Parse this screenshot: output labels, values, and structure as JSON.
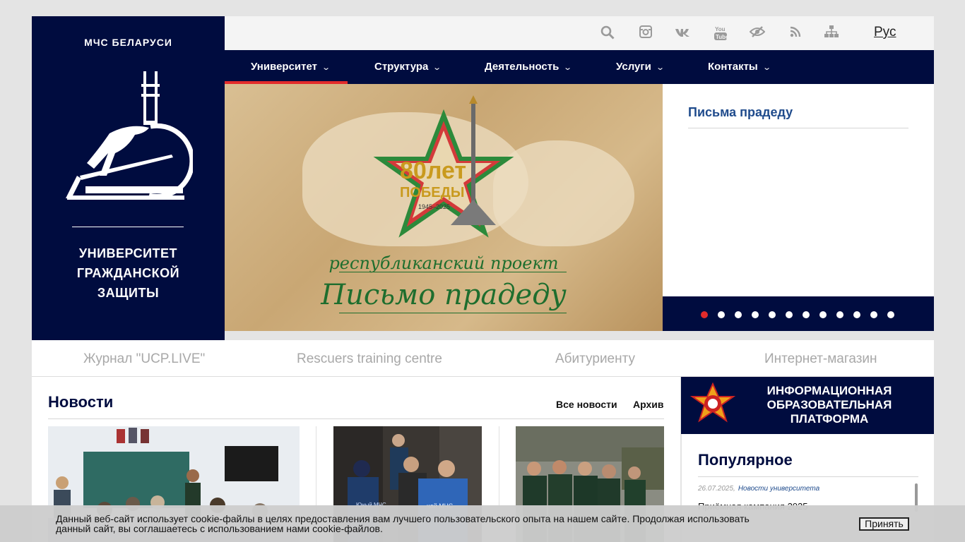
{
  "brand": {
    "org": "МЧС БЕЛАРУСИ",
    "university_line1": "УНИВЕРСИТЕТ",
    "university_line2": "ГРАЖДАНСКОЙ",
    "university_line3": "ЗАЩИТЫ"
  },
  "topbar": {
    "icons": [
      "search-icon",
      "instagram-icon",
      "vk-icon",
      "youtube-icon",
      "accessibility-eye-icon",
      "rss-icon",
      "sitemap-icon"
    ],
    "lang": "Рус"
  },
  "nav": {
    "items": [
      {
        "label": "Университет",
        "active": true
      },
      {
        "label": "Структура"
      },
      {
        "label": "Деятельность"
      },
      {
        "label": "Услуги"
      },
      {
        "label": "Контакты"
      }
    ]
  },
  "slider": {
    "badge_years": "80лет",
    "badge_word": "ПОБЕДЫ",
    "badge_range": "1945–2025",
    "project_text": "республиканский проект",
    "letter_text": "Письмо прадеду",
    "side_title": "Письма прадеду",
    "dot_count": 12,
    "active_dot": 0,
    "colors": {
      "accent": "#e32b2b",
      "navy": "#000c3f",
      "green": "#1e6e2e"
    }
  },
  "quick_links": [
    "Журнал \"UCP.LIVE\"",
    "Rescuers training centre",
    "Абитуриенту",
    "Интернет-магазин"
  ],
  "news": {
    "heading": "Новости",
    "all_news": "Все новости",
    "archive": "Архив"
  },
  "info_banner": {
    "line1": "ИНФОРМАЦИОННАЯ",
    "line2": "ОБРАЗОВАТЕЛЬНАЯ",
    "line3": "ПЛАТФОРМА"
  },
  "popular": {
    "heading": "Популярное",
    "items": [
      {
        "date": "26.07.2025,",
        "category": "Новости университета",
        "title": "Приёмная кампания 2025"
      }
    ]
  },
  "cookie": {
    "message": "Данный веб-сайт использует cookie-файлы в целях предоставления вам лучшего пользовательского опыта на нашем сайте. Продолжая использовать данный сайт, вы соглашаетесь с использованием нами cookie-файлов.",
    "accept": "Принять"
  }
}
